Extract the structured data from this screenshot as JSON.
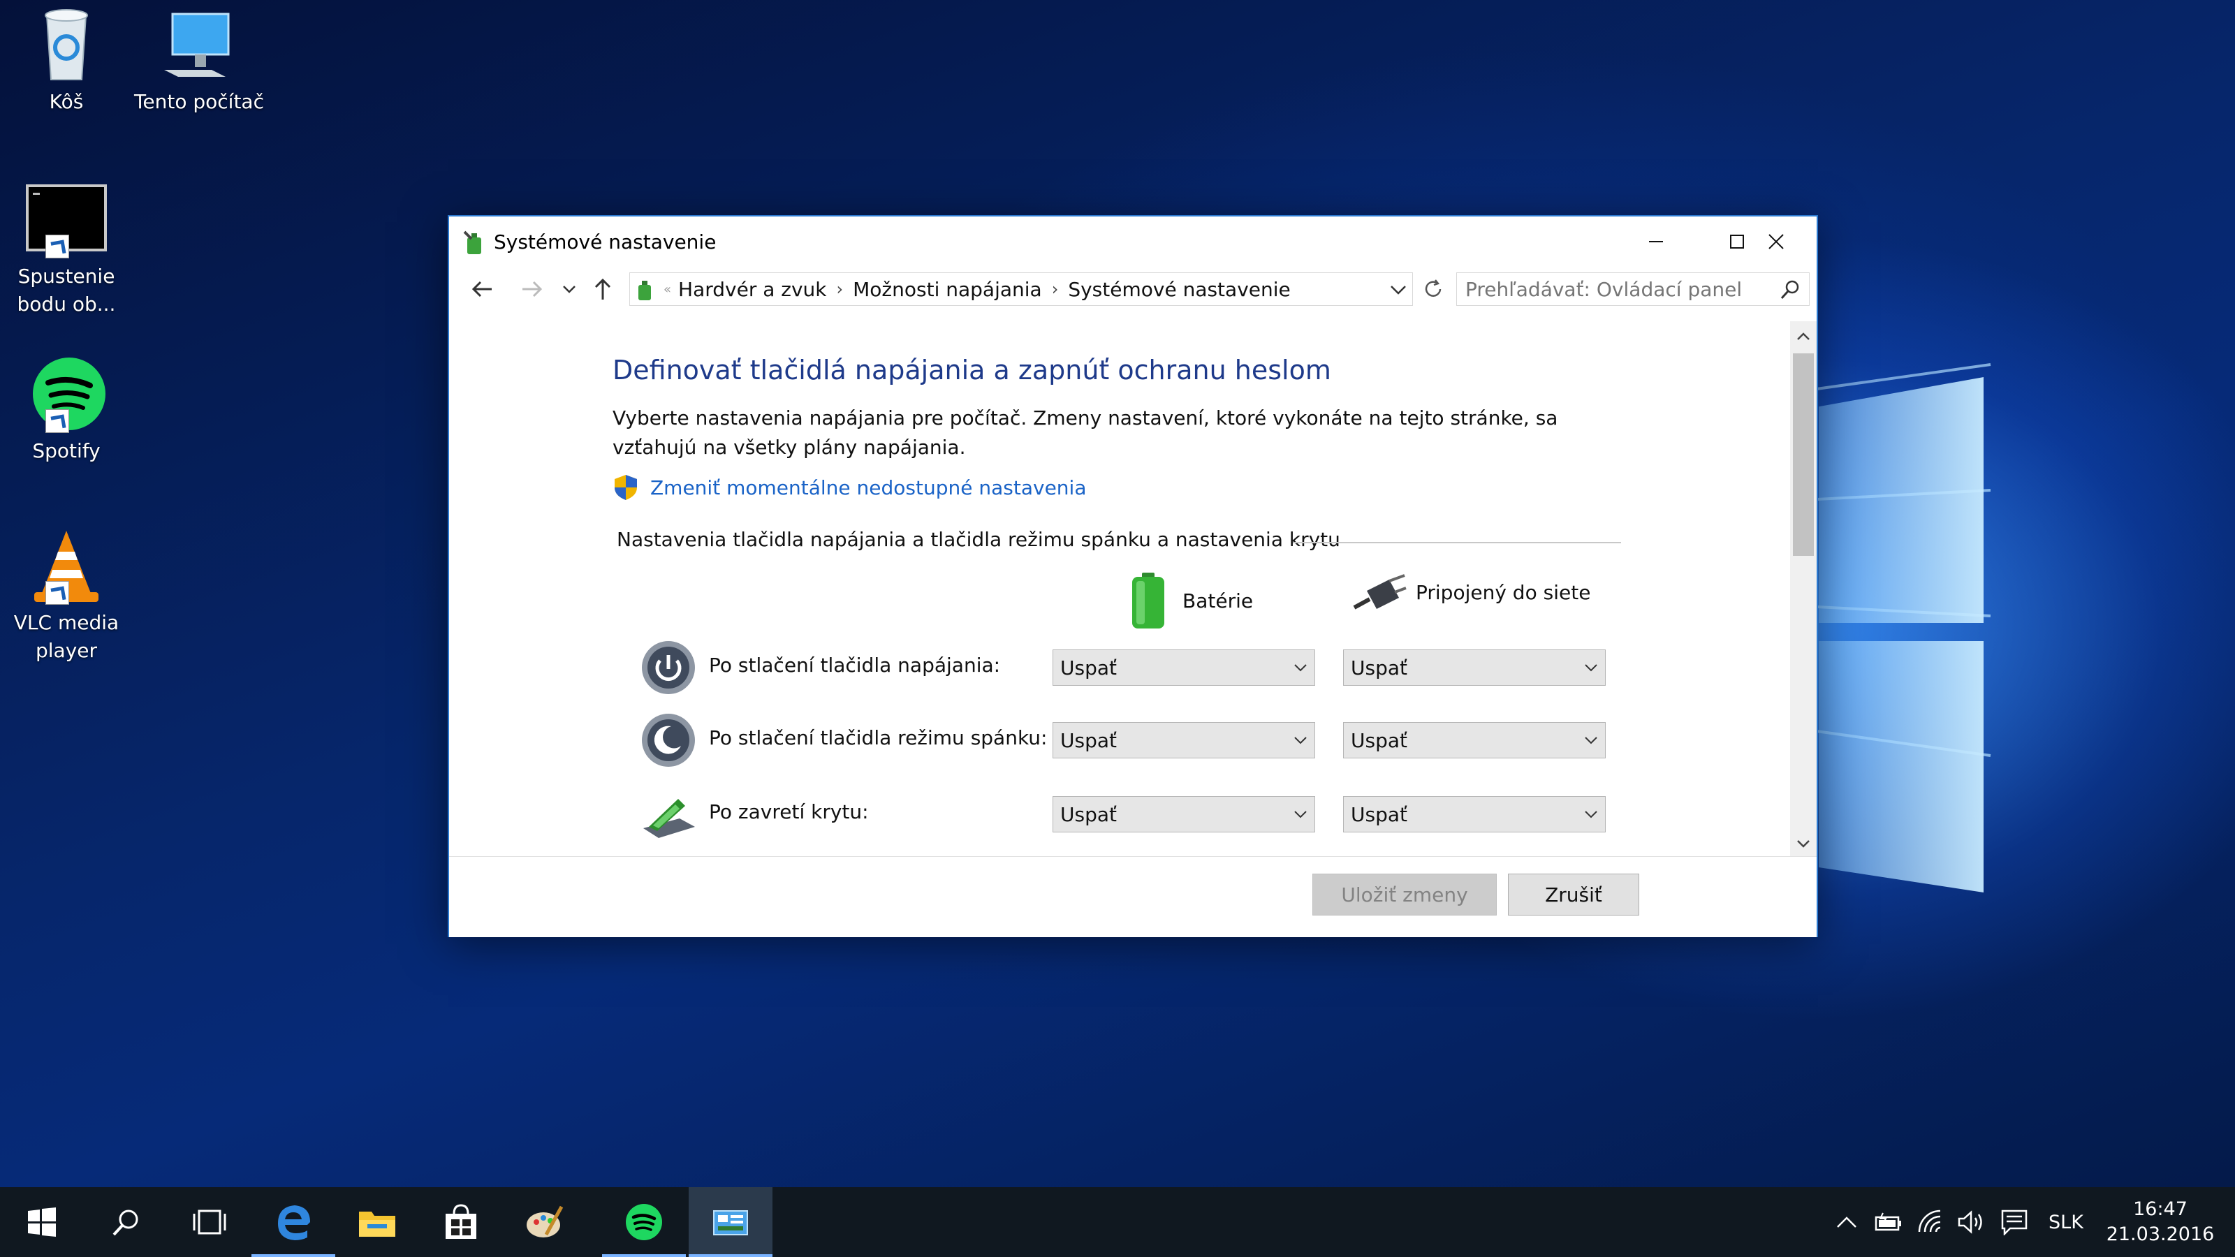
{
  "desktop": {
    "icons": [
      {
        "label": "Kôš",
        "icon": "recycle-bin-icon"
      },
      {
        "label": "Tento počítač",
        "icon": "this-pc-icon"
      },
      {
        "label": "Spustenie bodu ob...",
        "icon": "command-prompt-icon"
      },
      {
        "label": "Spotify",
        "icon": "spotify-icon"
      },
      {
        "label": "VLC media player",
        "icon": "vlc-icon"
      }
    ]
  },
  "window": {
    "title": "Systémové nastavenie",
    "breadcrumbs": [
      "Hardvér a zvuk",
      "Možnosti napájania",
      "Systémové nastavenie"
    ],
    "search_placeholder": "Prehľadávať: Ovládací panel",
    "heading": "Definovať tlačidlá napájania a zapnúť ochranu heslom",
    "description": "Vyberte nastavenia napájania pre počítač. Zmeny nastavení, ktoré vykonáte na tejto stránke, sa vzťahujú na všetky plány napájania.",
    "admin_link": "Zmeniť momentálne nedostupné nastavenia",
    "section_title": "Nastavenia tlačidla napájania a tlačidla režimu spánku a nastavenia krytu",
    "columns": {
      "battery": "Batérie",
      "plugged": "Pripojený do siete"
    },
    "rows": [
      {
        "label": "Po stlačení tlačidla napájania:",
        "battery": "Uspať",
        "plugged": "Uspať",
        "icon": "power-button-icon"
      },
      {
        "label": "Po stlačení tlačidla režimu spánku:",
        "battery": "Uspať",
        "plugged": "Uspať",
        "icon": "sleep-button-icon"
      },
      {
        "label": "Po zavretí krytu:",
        "battery": "Uspať",
        "plugged": "Uspať",
        "icon": "laptop-lid-icon"
      }
    ],
    "buttons": {
      "save": "Uložiť zmeny",
      "cancel": "Zrušiť"
    }
  },
  "taskbar": {
    "apps": [
      "start-icon",
      "search-icon",
      "task-view-icon",
      "edge-icon",
      "file-explorer-icon",
      "store-icon",
      "paint-icon",
      "spotify-icon",
      "control-panel-icon"
    ],
    "active_app": "control-panel-icon",
    "language": "SLK",
    "time": "16:47",
    "date": "21.03.2016"
  },
  "colors": {
    "accent": "#2b79d0",
    "heading": "#1e3a8a",
    "link": "#1a63c7",
    "taskbar": "#101820"
  }
}
